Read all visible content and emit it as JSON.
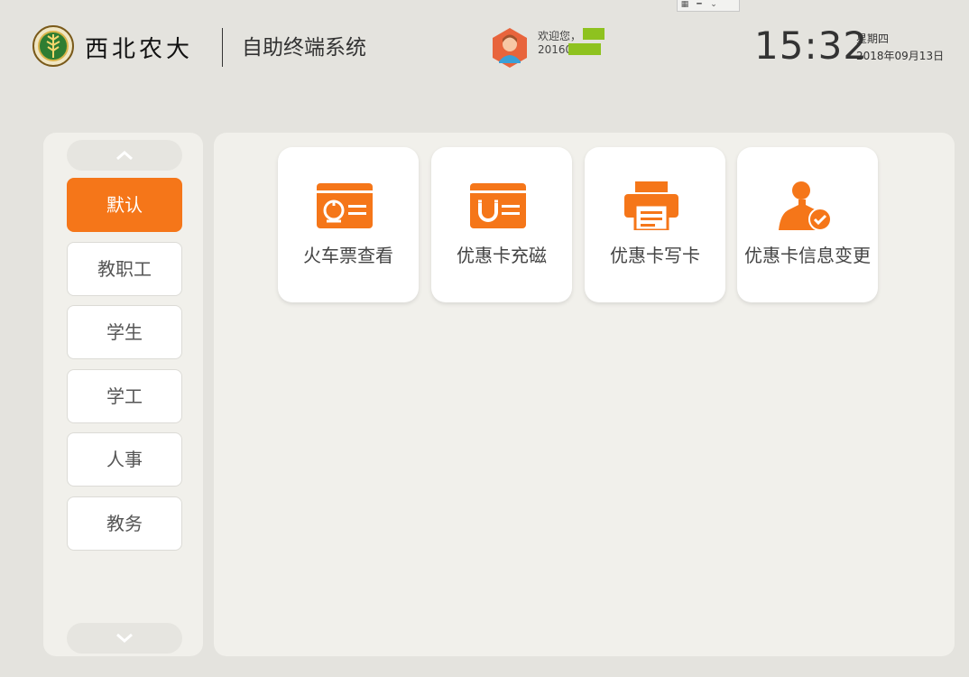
{
  "header": {
    "brand": "西北农大",
    "system_title": "自助终端系统",
    "welcome": "欢迎您，",
    "user_id_prefix": "20160",
    "time": "15:32",
    "weekday": "星期四",
    "date": "2018年09月13日"
  },
  "sidebar": {
    "items": [
      {
        "label": "默认",
        "active": true
      },
      {
        "label": "教职工",
        "active": false
      },
      {
        "label": "学生",
        "active": false
      },
      {
        "label": "学工",
        "active": false
      },
      {
        "label": "人事",
        "active": false
      },
      {
        "label": "教务",
        "active": false
      }
    ]
  },
  "tiles": [
    {
      "label": "火车票查看",
      "icon": "train-ticket-icon"
    },
    {
      "label": "优惠卡充磁",
      "icon": "magnet-card-icon"
    },
    {
      "label": "优惠卡写卡",
      "icon": "printer-icon"
    },
    {
      "label": "优惠卡信息变更",
      "icon": "user-check-icon"
    }
  ],
  "colors": {
    "accent": "#f57619",
    "background": "#e4e3de",
    "panel": "#f1f0eb",
    "redaction": "#8ec21f"
  }
}
